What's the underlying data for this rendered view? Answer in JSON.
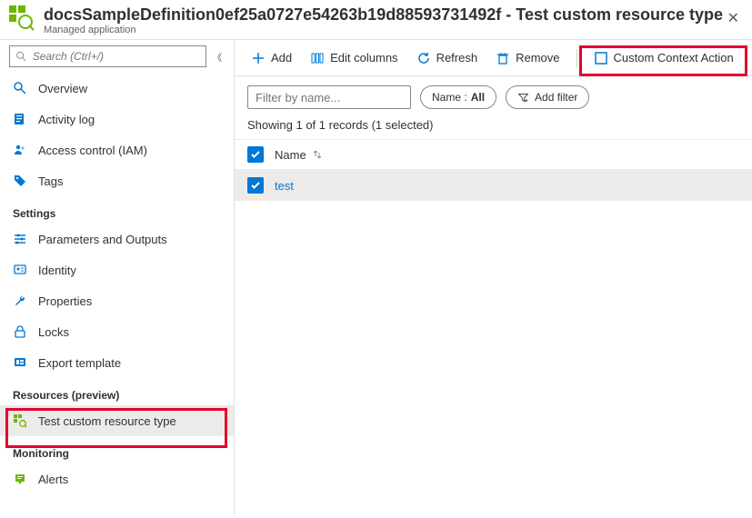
{
  "header": {
    "title": "docsSampleDefinition0ef25a0727e54263b19d88593731492f - Test custom resource type",
    "subtitle": "Managed application"
  },
  "sidebar": {
    "search_placeholder": "Search (Ctrl+/)",
    "groups": [
      {
        "label": null,
        "items": [
          {
            "icon": "overview",
            "label": "Overview"
          },
          {
            "icon": "activity",
            "label": "Activity log"
          },
          {
            "icon": "iam",
            "label": "Access control (IAM)"
          },
          {
            "icon": "tags",
            "label": "Tags"
          }
        ]
      },
      {
        "label": "Settings",
        "items": [
          {
            "icon": "params",
            "label": "Parameters and Outputs"
          },
          {
            "icon": "identity",
            "label": "Identity"
          },
          {
            "icon": "properties",
            "label": "Properties"
          },
          {
            "icon": "locks",
            "label": "Locks"
          },
          {
            "icon": "export",
            "label": "Export template"
          }
        ]
      },
      {
        "label": "Resources (preview)",
        "items": [
          {
            "icon": "custom",
            "label": "Test custom resource type",
            "active": true
          }
        ]
      },
      {
        "label": "Monitoring",
        "items": [
          {
            "icon": "alerts",
            "label": "Alerts"
          }
        ]
      }
    ]
  },
  "toolbar": {
    "add": "Add",
    "edit_columns": "Edit columns",
    "refresh": "Refresh",
    "remove": "Remove",
    "custom_action": "Custom Context Action"
  },
  "filters": {
    "placeholder": "Filter by name...",
    "name_pill_prefix": "Name :",
    "name_pill_value": "All",
    "add_filter": "Add filter"
  },
  "status": "Showing 1 of 1 records (1 selected)",
  "table": {
    "header": {
      "name": "Name"
    },
    "rows": [
      {
        "name": "test",
        "selected": true
      }
    ]
  }
}
